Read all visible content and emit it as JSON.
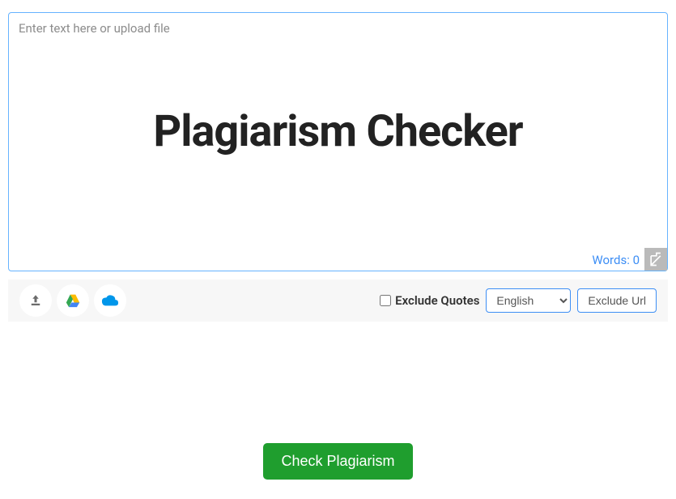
{
  "input": {
    "placeholder": "Enter text here or upload file",
    "watermark": "Plagiarism Checker",
    "word_count_label": "Words: ",
    "word_count": "0"
  },
  "toolbar": {
    "exclude_quotes_label": "Exclude Quotes",
    "language_options": [
      "English"
    ],
    "language_selected": "English",
    "exclude_url_label": "Exclude Url"
  },
  "submit": {
    "check_label": "Check Plagiarism"
  }
}
